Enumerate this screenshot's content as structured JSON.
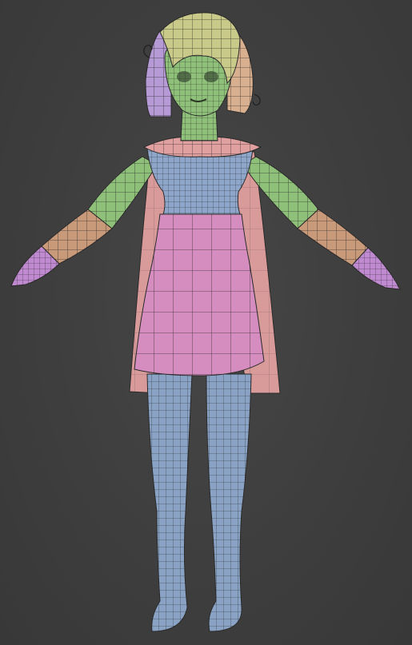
{
  "viewport": {
    "background": "#3d3d3d",
    "display_mode": "wireframe-on-shaded",
    "model": "stylized-girl-character-t-pose"
  },
  "material_colors": {
    "skin": "#8fc07a",
    "hair_yellow": "#c9c98a",
    "hair_purple": "#b59ad6",
    "hair_peach": "#d9b08f",
    "top": "#8ea6c9",
    "collar": "#e0a0a0",
    "skirt": "#d58dbf",
    "cape": "#d99a9a",
    "gloves_tan": "#c99a7a",
    "hands_violet": "#c08ad0",
    "legs": "#8aa3c5"
  },
  "icons": [
    "character-mesh"
  ]
}
